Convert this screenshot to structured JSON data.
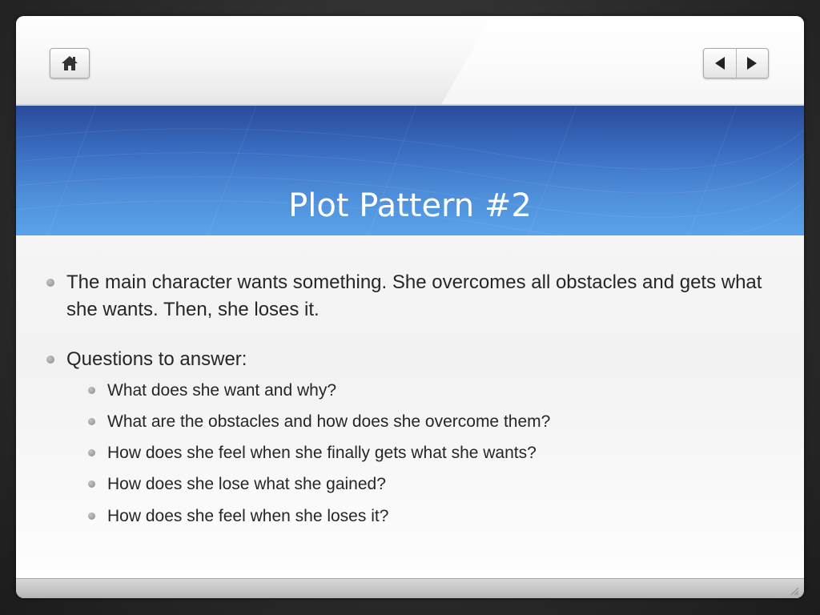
{
  "slide": {
    "title": "Plot Pattern #2",
    "bullets": [
      {
        "text": "The main character wants something.  She overcomes all obstacles and gets what she wants.  Then, she loses it."
      },
      {
        "text": "Questions to answer:",
        "sub": [
          "What does she want and why?",
          "What are the obstacles and how does she overcome them?",
          "How does she feel when she finally gets what she wants?",
          "How does she lose what she gained?",
          "How does she feel when she loses it?"
        ]
      }
    ]
  },
  "toolbar": {
    "home_icon": "home-icon",
    "prev_icon": "triangle-left-icon",
    "next_icon": "triangle-right-icon"
  },
  "colors": {
    "banner_top": "#2a4b9a",
    "banner_bottom": "#5aa3ea",
    "title_text": "#ffffff",
    "body_text": "#262626"
  }
}
